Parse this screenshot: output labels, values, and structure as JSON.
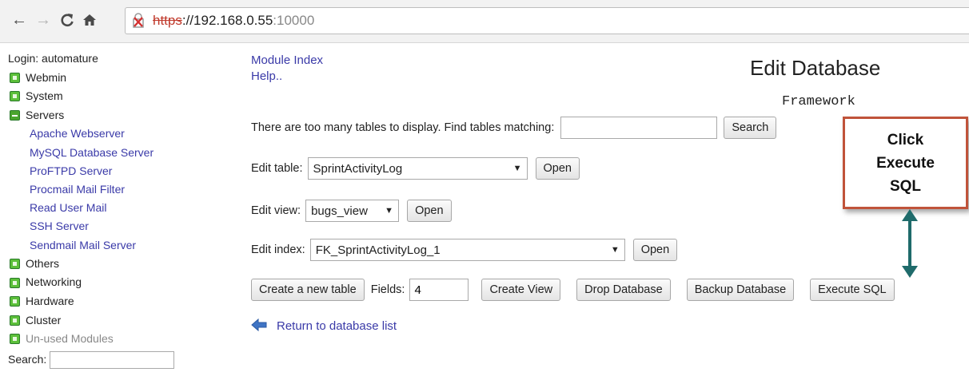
{
  "browser": {
    "url_scheme": "https",
    "url_host": "://192.168.0.55",
    "url_port": ":10000"
  },
  "sidebar": {
    "login": "Login: automature",
    "categories": [
      {
        "label": "Webmin"
      },
      {
        "label": "System"
      },
      {
        "label": "Servers"
      }
    ],
    "server_items": [
      "Apache Webserver",
      "MySQL Database Server",
      "ProFTPD Server",
      "Procmail Mail Filter",
      "Read User Mail",
      "SSH Server",
      "Sendmail Mail Server"
    ],
    "categories_after": [
      {
        "label": "Others"
      },
      {
        "label": "Networking"
      },
      {
        "label": "Hardware"
      },
      {
        "label": "Cluster"
      },
      {
        "label": "Un-used Modules"
      }
    ],
    "search_label": "Search:"
  },
  "main": {
    "module_index": "Module Index",
    "help": "Help..",
    "title": "Edit Database",
    "subtitle": "Framework",
    "find_tables_label": "There are too many tables to display. Find tables matching:",
    "search_button": "Search",
    "edit_table_label": "Edit table:",
    "edit_table_value": "SprintActivityLog",
    "edit_view_label": "Edit view:",
    "edit_view_value": "bugs_view",
    "edit_index_label": "Edit index:",
    "edit_index_value": "FK_SprintActivityLog_1",
    "open_button": "Open",
    "create_table_button": "Create a new table",
    "fields_label": "Fields:",
    "fields_value": "4",
    "create_view_button": "Create View",
    "drop_database_button": "Drop Database",
    "backup_database_button": "Backup Database",
    "execute_sql_button": "Execute SQL",
    "return_link": "Return to database list"
  },
  "annotation": {
    "callout_text": "Click\nExecute\nSQL",
    "callout_border_color": "#c0533a",
    "arrow_color": "#1f6b6b"
  }
}
